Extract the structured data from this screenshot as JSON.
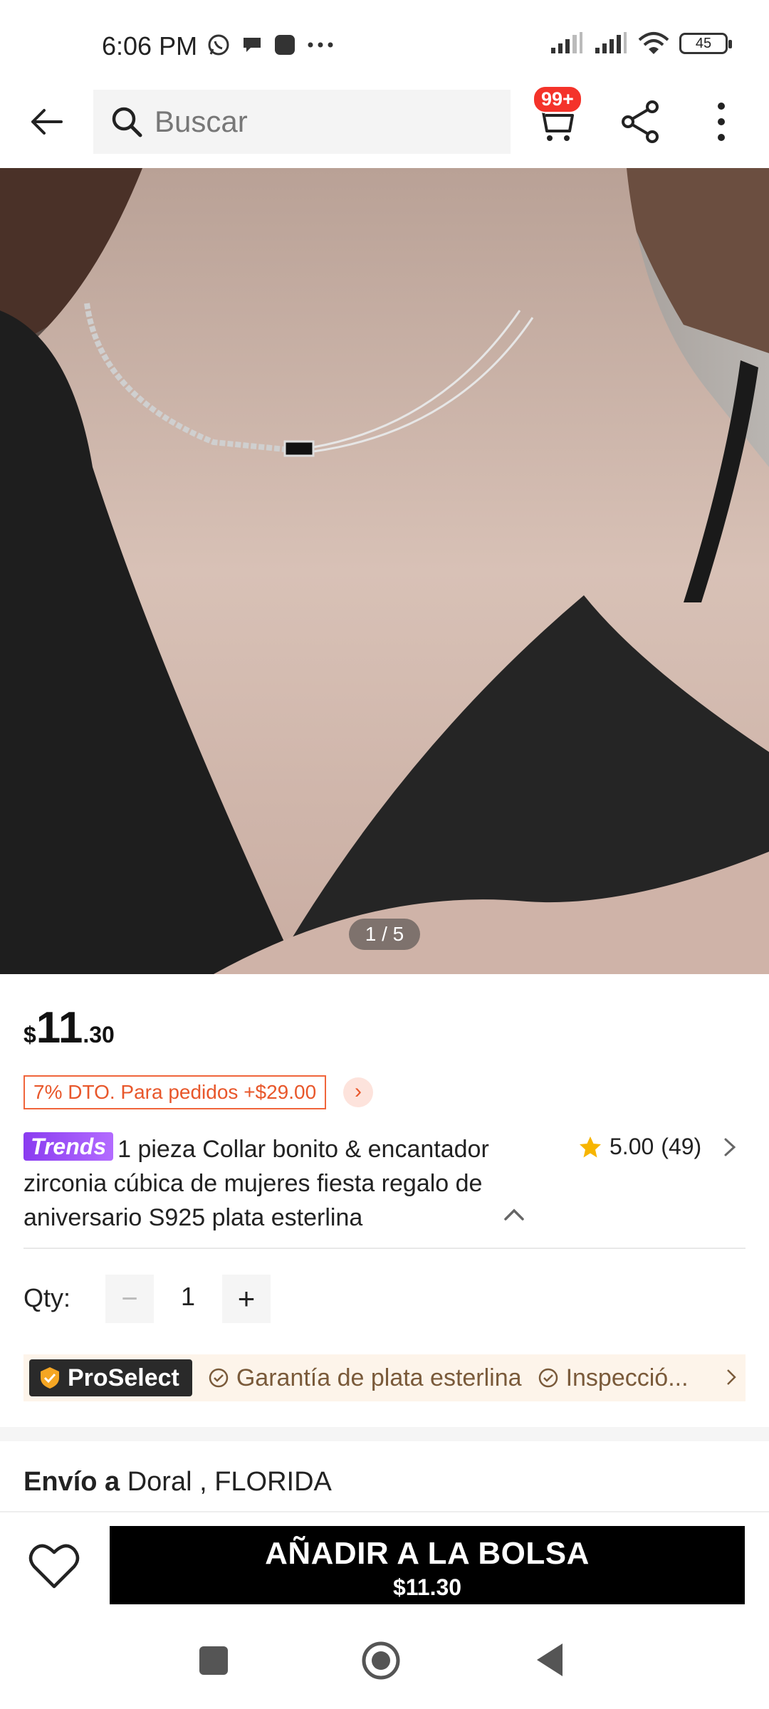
{
  "status_bar": {
    "time": "6:06 PM",
    "battery": "45"
  },
  "top_bar": {
    "search_placeholder": "Buscar",
    "cart_badge": "99+"
  },
  "hero": {
    "page_indicator": "1 / 5",
    "current_page": 1,
    "total_pages": 5
  },
  "product": {
    "price_currency": "$",
    "price_integer": "11",
    "price_decimal": ".30",
    "discount_text": "7% DTO. Para pedidos +$29.00",
    "trends_badge": "Trends",
    "title": "1 pieza Collar bonito & encantador zirconia cúbica de mujeres fiesta regalo de aniversario S925 plata esterlina",
    "rating_value": "5.00",
    "rating_count": "(49)"
  },
  "quantity": {
    "label": "Qty:",
    "minus": "−",
    "value": "1",
    "plus": "+"
  },
  "proselect": {
    "badge": "ProSelect",
    "items": [
      "Garantía de plata esterlina",
      "Inspecció..."
    ]
  },
  "shipping": {
    "label": "Envío a",
    "location": "Doral , FLORIDA"
  },
  "bottom_bar": {
    "add_button_label": "AÑADIR A LA BOLSA",
    "add_button_price": "$11.30"
  },
  "colors": {
    "accent_red": "#f4332a",
    "discount_orange": "#e8572b",
    "trends_purple": "#8a3cf0",
    "star_yellow": "#f7b500",
    "button_black": "#000000"
  }
}
